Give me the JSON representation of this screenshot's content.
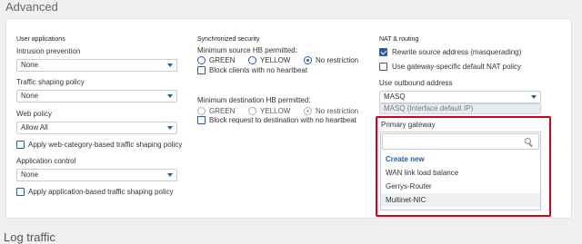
{
  "section_title": "Advanced",
  "bottom_title": "Log traffic",
  "user_apps": {
    "heading": "User applications",
    "intrusion_label": "Intrusion prevention",
    "intrusion_value": "None",
    "shaping_label": "Traffic shaping policy",
    "shaping_value": "None",
    "web_label": "Web policy",
    "web_value": "Allow All",
    "web_category_checkbox": "Apply web-category-based traffic shaping policy",
    "app_control_label": "Application control",
    "app_control_value": "None",
    "app_shaping_checkbox": "Apply application-based traffic shaping policy"
  },
  "sync_security": {
    "heading": "Synchronized security",
    "min_source_label": "Minimum source HB permitted:",
    "min_dest_label": "Minimum destination HB permitted:",
    "options": [
      "GREEN",
      "YELLOW",
      "No restriction"
    ],
    "block_clients_label": "Block clients with no heartbeat",
    "block_request_label": "Block request to destination with no heartbeat"
  },
  "nat": {
    "heading": "NAT & routing",
    "rewrite_label": "Rewrite source address (masquerading)",
    "gateway_nat_label": "Use gateway-specific default NAT policy",
    "outbound_label": "Use outbound address",
    "outbound_value": "MASQ",
    "outbound_interface": "MASQ (Interface default IP)",
    "primary_gateway_label": "Primary gateway",
    "search_placeholder": "",
    "gateway_options": [
      "Create new",
      "WAN link load balance",
      "Gerrys-Router",
      "Multinet-NIC"
    ]
  },
  "colors": {
    "accent": "#1f5fa8",
    "highlight": "#d0021b"
  },
  "icons": [
    "chevron-down-icon",
    "search-icon",
    "checkbox-checked-icon"
  ]
}
